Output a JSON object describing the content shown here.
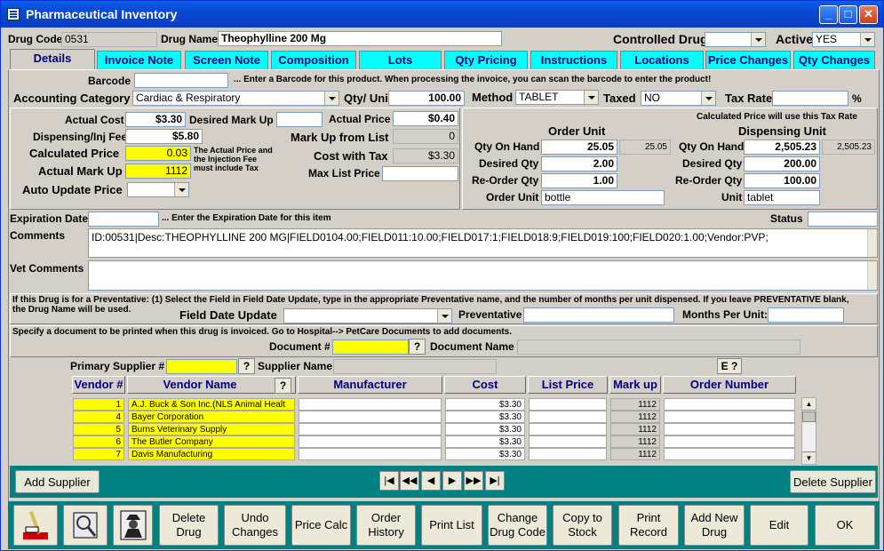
{
  "window": {
    "title": "Pharmaceutical Inventory"
  },
  "header": {
    "drug_code_label": "Drug Code",
    "drug_code": "0531",
    "drug_name_label": "Drug Name",
    "drug_name": "Theophylline 200 Mg",
    "controlled_label": "Controlled Drug",
    "controlled_value": "",
    "active_label": "Active",
    "active_value": "YES"
  },
  "tabs": [
    "Details",
    "Invoice Note",
    "Screen Note",
    "Composition",
    "Lots",
    "Qty Pricing",
    "Instructions",
    "Locations",
    "Price Changes",
    "Qty Changes"
  ],
  "details": {
    "barcode_label": "Barcode",
    "barcode_hint": "... Enter a Barcode for this product.  When processing the invoice, you can scan the barcode to enter the product!",
    "acct_label": "Accounting Category",
    "acct_value": "Cardiac & Respiratory",
    "qty_unit_label": "Qty/ Unit",
    "qty_unit": "100.00",
    "method_label": "Method",
    "method_value": "TABLET",
    "taxed_label": "Taxed",
    "taxed_value": "NO",
    "tax_rate_label": "Tax Rate",
    "tax_rate": "",
    "pct": "%"
  },
  "pricing": {
    "actual_cost_label": "Actual Cost",
    "actual_cost": "$3.30",
    "desired_markup_label": "Desired Mark Up",
    "desired_markup": "",
    "actual_price_label": "Actual Price",
    "actual_price": "$0.40",
    "disp_fee_label": "Dispensing/Inj Fee",
    "disp_fee": "$5.80",
    "markup_list_label": "Mark Up from List",
    "markup_list": "0",
    "calc_price_label": "Calculated Price",
    "calc_price": "0.03",
    "note": "The Actual Price and the Injection Fee must include Tax",
    "cost_tax_label": "Cost with Tax",
    "cost_tax": "$3.30",
    "actual_markup_label": "Actual Mark Up",
    "actual_markup": "1112",
    "max_list_label": "Max List Price",
    "max_list": "",
    "auto_update_label": "Auto Update Price",
    "auto_update": ""
  },
  "units": {
    "tax_note": "Calculated Price will use this Tax Rate",
    "order_unit_title": "Order Unit",
    "disp_unit_title": "Dispensing Unit",
    "qty_on_hand_label": "Qty On Hand",
    "desired_qty_label": "Desired Qty",
    "reorder_qty_label": "Re-Order Qty",
    "order_unit_label": "Order Unit",
    "unit_label": "Unit",
    "order": {
      "on_hand": "25.05",
      "on_hand_gray": "25.05",
      "desired": "2.00",
      "reorder": "1.00",
      "unit": "bottle"
    },
    "disp": {
      "on_hand": "2,505.23",
      "on_hand_gray": "2,505.23",
      "desired": "200.00",
      "reorder": "100.00",
      "unit": "tablet"
    }
  },
  "misc": {
    "exp_label": "Expiration Date",
    "exp_hint": "... Enter the Expiration Date for this item",
    "exp_value": "",
    "status_label": "Status",
    "status_value": "",
    "comments_label": "Comments",
    "comments": "ID:00531|Desc:THEOPHYLLINE 200 MG|FIELD0104.00;FIELD011:10.00;FIELD017:1;FIELD018:9;FIELD019:100;FIELD020:1.00;Vendor:PVP;",
    "vet_comments_label": "Vet Comments",
    "vet_comments": ""
  },
  "preventative": {
    "note": "If this Drug is for a Preventative: (1) Select the Field in Field Date Update, type in the appropriate Preventative name, and the number of months per unit dispensed.  If you leave PREVENTATIVE blank, the Drug Name will be used.",
    "field_date_label": "Field Date Update",
    "field_date": "",
    "prev_label": "Preventative",
    "prev_value": "",
    "months_label": "Months Per Unit:",
    "months_value": ""
  },
  "document": {
    "note": "Specify a document to be printed when this drug is invoiced.  Go to Hospital--> PetCare Documents to add documents.",
    "doc_num_label": "Document #",
    "doc_num": "",
    "doc_name_label": "Document Name",
    "doc_name": ""
  },
  "supplier": {
    "primary_label": "Primary Supplier #",
    "primary_value": "",
    "name_label": "Supplier Name",
    "name_value": "",
    "e_btn": "E ?",
    "q": "?",
    "columns": [
      "Vendor #",
      "Vendor Name",
      "Manufacturer",
      "Cost",
      "List Price",
      "Mark up",
      "Order Number"
    ],
    "rows": [
      {
        "num": "1",
        "name": "A.J. Buck & Son Inc.(NLS Animal Healt",
        "mfr": "",
        "cost": "$3.30",
        "list": "",
        "markup": "1112",
        "order": ""
      },
      {
        "num": "4",
        "name": "Bayer Corporation",
        "mfr": "",
        "cost": "$3.30",
        "list": "",
        "markup": "1112",
        "order": ""
      },
      {
        "num": "5",
        "name": "Burns Veterinary Supply",
        "mfr": "",
        "cost": "$3.30",
        "list": "",
        "markup": "1112",
        "order": ""
      },
      {
        "num": "6",
        "name": "The Butler Company",
        "mfr": "",
        "cost": "$3.30",
        "list": "",
        "markup": "1112",
        "order": ""
      },
      {
        "num": "7",
        "name": "Davis Manufacturing",
        "mfr": "",
        "cost": "$3.30",
        "list": "",
        "markup": "1112",
        "order": ""
      }
    ],
    "add_btn": "Add Supplier",
    "delete_btn": "Delete Supplier"
  },
  "toolbar": {
    "buttons": [
      "Delete Drug",
      "Undo Changes",
      "Price Calc",
      "Order History",
      "Print List",
      "Change Drug Code",
      "Copy to Stock",
      "Print Record",
      "Add New Drug",
      "Edit",
      "OK"
    ]
  },
  "colors": {
    "titlebar": "#0a4fd8",
    "tab": "#00ffff",
    "highlight": "#ffff00",
    "teal": "#008080"
  }
}
